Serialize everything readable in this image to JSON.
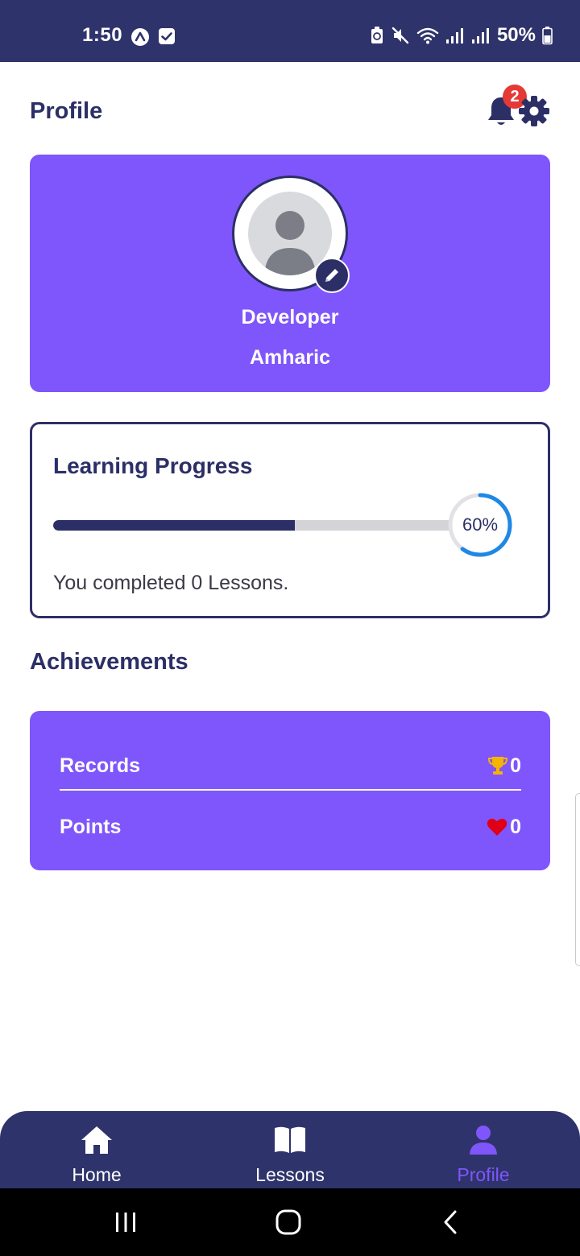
{
  "status_bar": {
    "time": "1:50",
    "battery": "50%"
  },
  "header": {
    "title": "Profile",
    "notification_count": "2",
    "icons": [
      "bell-icon",
      "gear-icon"
    ]
  },
  "profile": {
    "username": "Developer",
    "language": "Amharic",
    "icons": [
      "avatar-placeholder-icon",
      "pencil-icon"
    ]
  },
  "progress": {
    "title": "Learning Progress",
    "percent_label": "60%",
    "percent_value": 60,
    "completed_text": "You completed 0 Lessons."
  },
  "achievements": {
    "title": "Achievements",
    "items": [
      {
        "label": "Records",
        "value": "0",
        "icon": "trophy-icon"
      },
      {
        "label": "Points",
        "value": "0",
        "icon": "heart-icon"
      }
    ]
  },
  "bottom_nav": {
    "items": [
      {
        "label": "Home",
        "icon": "home-icon"
      },
      {
        "label": "Lessons",
        "icon": "book-icon"
      },
      {
        "label": "Profile",
        "icon": "person-icon"
      }
    ],
    "active": "Profile"
  },
  "colors": {
    "primary_dark": "#2f336b",
    "accent_purple": "#7f56fb",
    "progress_blue": "#1e88e5",
    "badge_red": "#e53935",
    "trophy_gold": "#f5b400",
    "heart_red": "#e00016"
  }
}
